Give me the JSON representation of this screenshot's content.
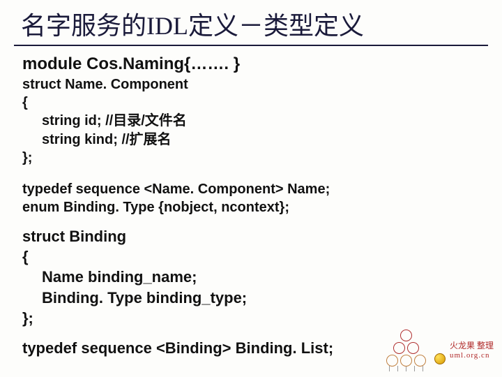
{
  "title": "名字服务的IDL定义－类型定义",
  "code": {
    "module": "module Cos.Naming{……. }",
    "struct_nc": "struct Name. Component",
    "brace_open": " {",
    "field_id": "string id; //目录/文件名",
    "field_kind": "string kind; //扩展名",
    "brace_close": "};",
    "typedef_name": " typedef sequence <Name. Component> Name;",
    "enum_bt": "enum Binding. Type {nobject, ncontext};",
    "struct_b": "struct Binding",
    "b_open": "{",
    "b_name": "Name     binding_name;",
    "b_type": "Binding. Type   binding_type;",
    "b_close": "};",
    "typedef_blist": "typedef sequence <Binding> Binding. List;"
  },
  "footer": {
    "brand": "火龙果 整理",
    "url": "uml.org.cn"
  }
}
